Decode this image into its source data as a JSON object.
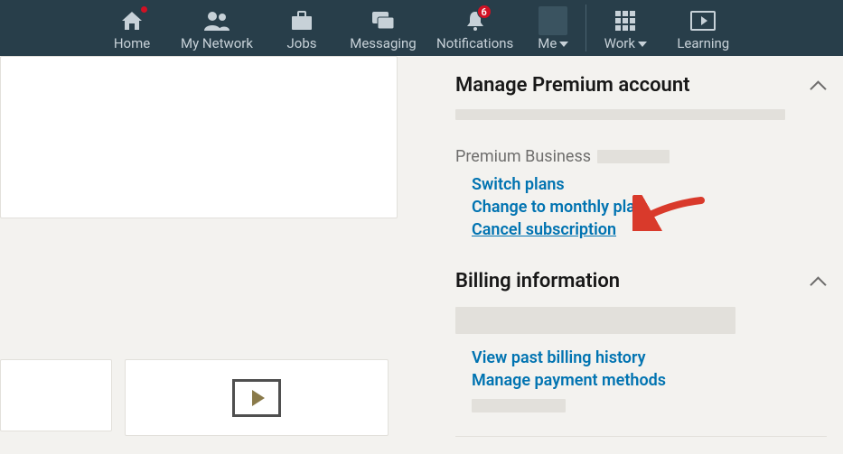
{
  "nav": {
    "home": "Home",
    "network": "My Network",
    "jobs": "Jobs",
    "messaging": "Messaging",
    "notifications": "Notifications",
    "notifications_badge": "6",
    "me": "Me",
    "work": "Work",
    "learning": "Learning"
  },
  "premium": {
    "title": "Manage Premium account",
    "plan_label": "Premium Business",
    "links": {
      "switch": "Switch plans",
      "monthly": "Change to monthly plan",
      "cancel": "Cancel subscription"
    }
  },
  "billing": {
    "title": "Billing information",
    "links": {
      "history": "View past billing history",
      "payment": "Manage payment methods"
    }
  }
}
